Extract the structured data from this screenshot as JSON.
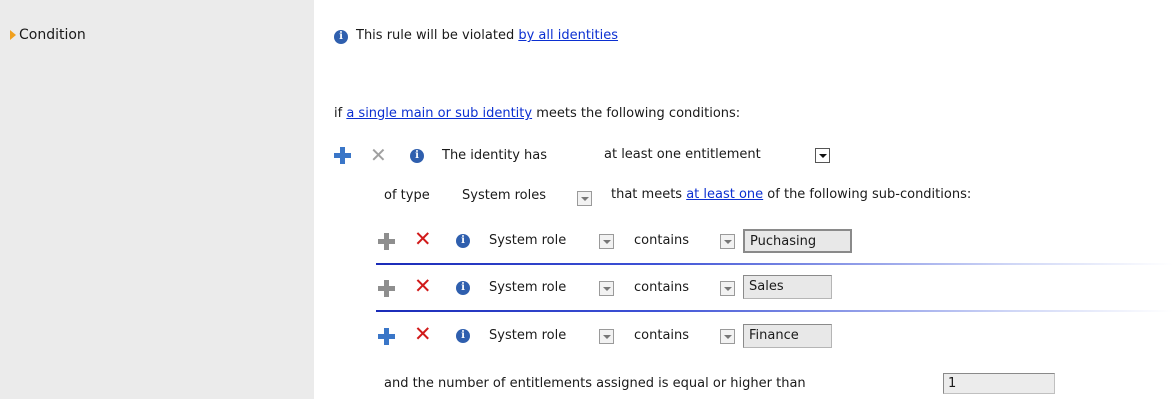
{
  "left": {
    "condition_label": "Condition"
  },
  "header": {
    "text": "This rule will be violated ",
    "link": "by all identities"
  },
  "if_line": {
    "prefix": "if ",
    "link": "a single main or sub identity",
    "suffix": " meets the following conditions:"
  },
  "main_condition": {
    "label": "The identity has",
    "quantifier": "at least one entitlement"
  },
  "type_line": {
    "prefix": "of type",
    "type_value": "System roles",
    "text": "that meets ",
    "link": "at least one",
    "suffix": " of the following sub-conditions:"
  },
  "sub_conditions": [
    {
      "field": "System role",
      "operator": "contains",
      "value": "Puchasing"
    },
    {
      "field": "System role",
      "operator": "contains",
      "value": "Sales"
    },
    {
      "field": "System role",
      "operator": "contains",
      "value": "Finance"
    }
  ],
  "threshold": {
    "text": "and the number of entitlements assigned is equal or higher than",
    "value": "1"
  },
  "icons": {
    "add": "plus-icon",
    "remove": "x-icon",
    "info": "info-icon",
    "dropdown": "chevron-down-icon",
    "expand": "triangle-right-icon"
  },
  "colors": {
    "link": "#0b2fd1",
    "add_blue": "#3a76c8",
    "remove_red": "#d11a1a",
    "panel_gray": "#ebebeb",
    "expander_orange": "#f0a01e"
  }
}
